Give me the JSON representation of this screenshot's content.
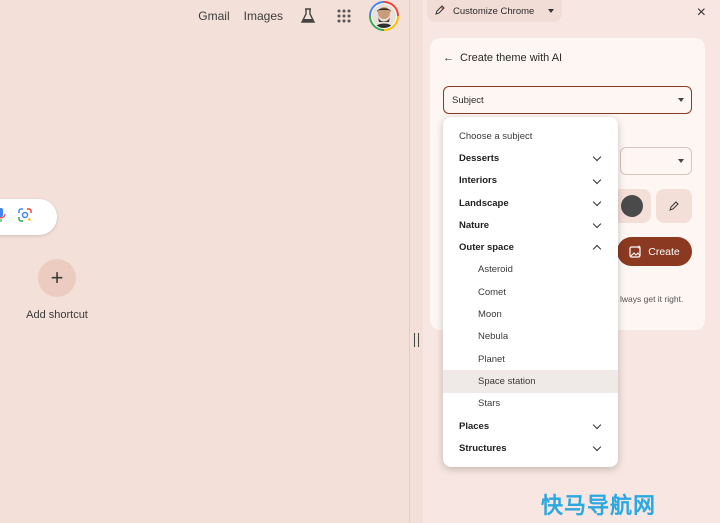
{
  "ntp": {
    "links": {
      "gmail": "Gmail",
      "images": "Images"
    },
    "shortcut_plus": "+",
    "shortcut_label": "Add shortcut"
  },
  "panel": {
    "header_label": "Customize Chrome",
    "close": "×",
    "back_arrow": "←",
    "card_title": "Create theme with AI",
    "subject_value": "Subject",
    "create_label": "Create",
    "disclaimer": "lways get it right."
  },
  "dropdown": {
    "header": "Choose a subject",
    "items": [
      {
        "label": "Desserts",
        "type": "category",
        "chevron": "down"
      },
      {
        "label": "Interiors",
        "type": "category",
        "chevron": "down"
      },
      {
        "label": "Landscape",
        "type": "category",
        "chevron": "down"
      },
      {
        "label": "Nature",
        "type": "category",
        "chevron": "down"
      },
      {
        "label": "Outer space",
        "type": "category",
        "chevron": "up"
      },
      {
        "label": "Asteroid",
        "type": "child"
      },
      {
        "label": "Comet",
        "type": "child"
      },
      {
        "label": "Moon",
        "type": "child"
      },
      {
        "label": "Nebula",
        "type": "child"
      },
      {
        "label": "Planet",
        "type": "child"
      },
      {
        "label": "Space station",
        "type": "child",
        "hover": true
      },
      {
        "label": "Stars",
        "type": "child"
      },
      {
        "label": "Places",
        "type": "category",
        "chevron": "down"
      },
      {
        "label": "Structures",
        "type": "category",
        "chevron": "down"
      }
    ]
  },
  "watermark": "快马导航网",
  "colors": {
    "accent": "#8b3a21",
    "background": "#f3e0d8",
    "panel": "#f7e6e1"
  }
}
